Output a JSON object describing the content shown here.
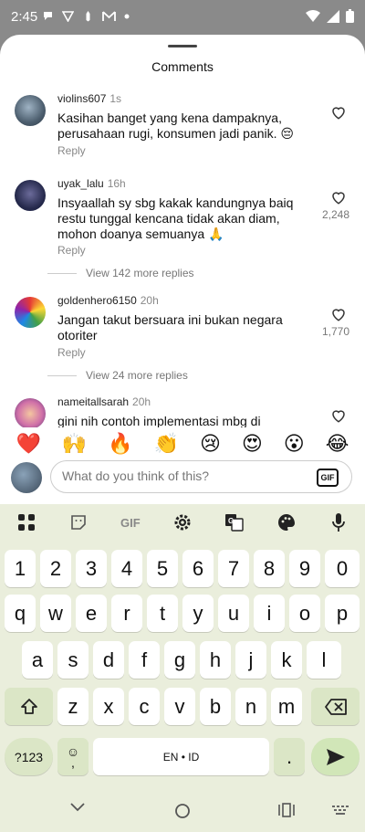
{
  "status": {
    "time": "2:45",
    "icons": [
      "app-icon-1",
      "app-icon-2",
      "app-icon-3",
      "gmail-icon",
      "dot-icon"
    ],
    "right_icons": [
      "wifi-icon",
      "signal-icon",
      "battery-icon"
    ]
  },
  "sheet": {
    "title": "Comments"
  },
  "comments": [
    {
      "user": "violins607",
      "time": "1s",
      "text": "Kasihan banget yang kena dampaknya, perusahaan rugi, konsumen jadi panik. 😔",
      "reply": "Reply",
      "likes": ""
    },
    {
      "user": "uyak_lalu",
      "time": "16h",
      "text": "Insyaallah sy sbg kakak kandungnya baiq restu tunggal kencana tidak akan diam, mohon doanya semuanya 🙏",
      "reply": "Reply",
      "likes": "2,248",
      "more": "View 142 more replies"
    },
    {
      "user": "goldenhero6150",
      "time": "20h",
      "text": "Jangan takut bersuara ini bukan negara otoriter",
      "reply": "Reply",
      "likes": "1,770",
      "more": "View 24 more replies"
    },
    {
      "user": "nameitallsarah",
      "time": "20h",
      "text": "gini nih contoh implementasi mbg di",
      "reply": "",
      "likes": ""
    }
  ],
  "emojis": [
    "❤️",
    "🙌",
    "🔥",
    "👏",
    "😢",
    "😍",
    "😮",
    "😂"
  ],
  "input": {
    "placeholder": "What do you think of this?",
    "gif_label": "GIF",
    "value": ""
  },
  "keyboard": {
    "toolbar": [
      "apps-icon",
      "sticker-icon",
      "GIF",
      "settings-icon",
      "translate-icon",
      "palette-icon",
      "mic-icon"
    ],
    "gif_label": "GIF",
    "row_numbers": [
      "1",
      "2",
      "3",
      "4",
      "5",
      "6",
      "7",
      "8",
      "9",
      "0"
    ],
    "row1": [
      "q",
      "w",
      "e",
      "r",
      "t",
      "y",
      "u",
      "i",
      "o",
      "p"
    ],
    "row2": [
      "a",
      "s",
      "d",
      "f",
      "g",
      "h",
      "j",
      "k",
      "l"
    ],
    "row3": [
      "z",
      "x",
      "c",
      "v",
      "b",
      "n",
      "m"
    ],
    "symbols_label": "?123",
    "emoji_key": "☺",
    "comma": ",",
    "space_label": "EN • ID",
    "period": "."
  },
  "colors": {
    "keyboard_bg": "#eaeedc",
    "special_key": "#dbe6c6",
    "enter_key": "#d1e6b8"
  }
}
